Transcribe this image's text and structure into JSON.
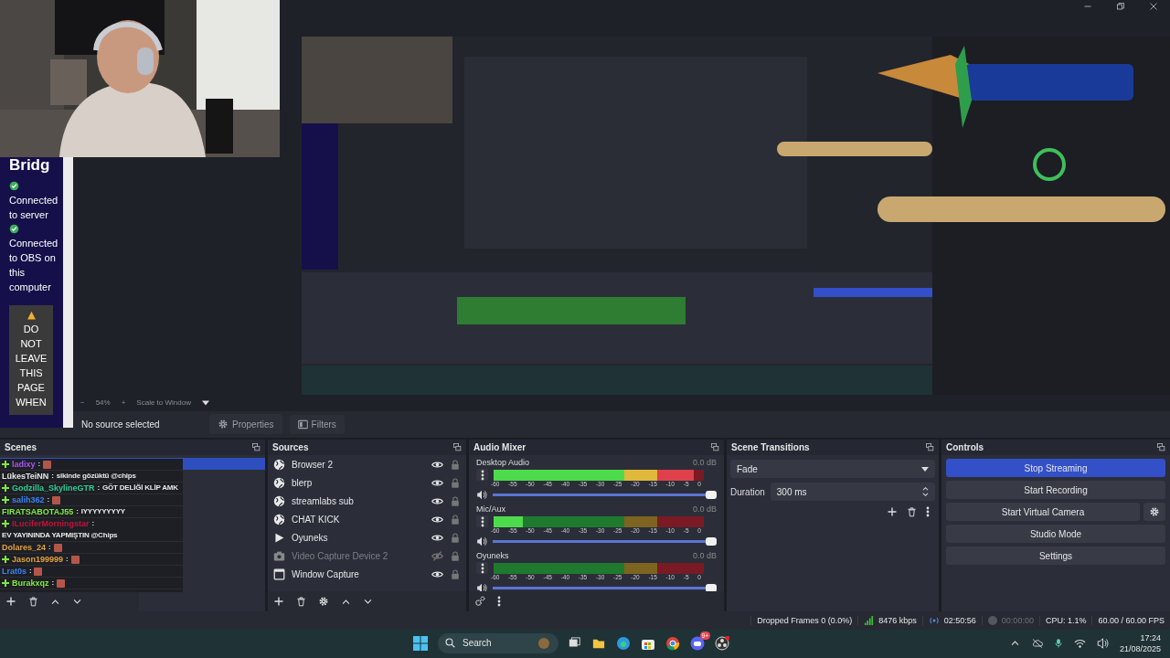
{
  "bridge": {
    "title": "Bridg",
    "statuses": [
      {
        "text": "Connected to server",
        "ok": true
      },
      {
        "text": "Connected to OBS on this computer",
        "ok": true
      }
    ],
    "warning": "DO NOT LEAVE THIS PAGE WHEN"
  },
  "chat": [
    {
      "user": "ladixy",
      "color": "#a855f7",
      "badge": true,
      "separator": ":",
      "emote": true
    },
    {
      "user": "LükesTeiNN",
      "color": "#e5e5e5",
      "badge": false,
      "separator": ":",
      "text": "sikinde gözüktü @chips",
      "emote": false
    },
    {
      "user": "Godzilla_SkylineGTR",
      "color": "#2ecc8f",
      "badge": true,
      "separator": ":",
      "text": "GÖT DELİĞİ KLİP AMK",
      "emote": false
    },
    {
      "user": "salih362",
      "color": "#3b82f6",
      "badge": true,
      "separator": ":",
      "emote": true
    },
    {
      "user": "FIRATSABOTAJ55",
      "color": "#7ee83f",
      "badge": false,
      "separator": ":",
      "text": "IYYYYYYYYY",
      "emote": false
    },
    {
      "user": "ILuciferMorningstar",
      "color": "#c0143c",
      "badge": true,
      "separator": ":",
      "text": "EV YAYININDA YAPMIŞTIN @Chips",
      "emote": false
    },
    {
      "user": "Dolares_24",
      "color": "#e0a040",
      "badge": false,
      "separator": ":",
      "emote": true
    },
    {
      "user": "Jason199999",
      "color": "#e0a040",
      "badge": true,
      "separator": ":",
      "emote": true
    },
    {
      "user": "Lrat0s",
      "color": "#3b82f6",
      "badge": false,
      "separator": ":",
      "emote": true
    },
    {
      "user": "Burakxqz",
      "color": "#7ee83f",
      "badge": true,
      "separator": ":",
      "emote": true
    }
  ],
  "preview_toolbar": {
    "zoom_out": "−",
    "zoom": "54%",
    "zoom_in": "+",
    "scale_mode": "Scale to Window"
  },
  "source_bar": {
    "status": "No source selected",
    "properties": "Properties",
    "filters": "Filters"
  },
  "scenes": {
    "title": "Scenes"
  },
  "sources": {
    "title": "Sources",
    "items": [
      {
        "name": "Browser 2",
        "kind": "browser",
        "visible": true
      },
      {
        "name": "blerp",
        "kind": "browser",
        "visible": true
      },
      {
        "name": "streamlabs sub",
        "kind": "browser",
        "visible": true
      },
      {
        "name": "CHAT KICK",
        "kind": "browser",
        "visible": true
      },
      {
        "name": "Oyuneks",
        "kind": "media",
        "visible": true
      },
      {
        "name": "Video Capture Device 2",
        "kind": "camera",
        "visible": false
      },
      {
        "name": "Window Capture",
        "kind": "window",
        "visible": true
      }
    ]
  },
  "audio_mixer": {
    "title": "Audio Mixer",
    "channels": [
      {
        "name": "Desktop Audio",
        "reading": "0.0 dB",
        "level": 0.95,
        "volume_slider": {
          "level": 1
        },
        "scale": [
          "-60",
          "-55",
          "-50",
          "-45",
          "-40",
          "-35",
          "-30",
          "-25",
          "-20",
          "-15",
          "-10",
          "-5",
          "0"
        ]
      },
      {
        "name": "Mic/Aux",
        "reading": "0.0 dB",
        "level": 0.14,
        "volume_slider": {
          "level": 1
        },
        "scale": [
          "-60",
          "-55",
          "-50",
          "-45",
          "-40",
          "-35",
          "-30",
          "-25",
          "-20",
          "-15",
          "-10",
          "-5",
          "0"
        ]
      },
      {
        "name": "Oyuneks",
        "reading": "0.0 dB",
        "level": 0,
        "volume_slider": {
          "level": 1
        },
        "scale": [
          "-60",
          "-55",
          "-50",
          "-45",
          "-40",
          "-35",
          "-30",
          "-25",
          "-20",
          "-15",
          "-10",
          "-5",
          "0"
        ]
      }
    ]
  },
  "scene_transitions": {
    "title": "Scene Transitions",
    "transition": "Fade",
    "duration_label": "Duration",
    "duration": "300 ms"
  },
  "controls": {
    "title": "Controls",
    "buttons": [
      {
        "label": "Stop Streaming",
        "active": true
      },
      {
        "label": "Start Recording",
        "active": false
      },
      {
        "label": "Start Virtual Camera",
        "active": false
      },
      {
        "label": "Studio Mode",
        "active": false
      },
      {
        "label": "Settings",
        "active": false
      }
    ]
  },
  "status_bar": {
    "dropped_frames": "Dropped Frames 0 (0.0%)",
    "bitrate": "8476 kbps",
    "stream_time": "02:50:56",
    "record_time": "00:00:00",
    "cpu": "CPU: 1.1%",
    "fps": "60.00 / 60.00 FPS"
  },
  "taskbar": {
    "search": "Search",
    "discord_badge": "9+",
    "time": "17:24",
    "date": "21/08/2025"
  }
}
